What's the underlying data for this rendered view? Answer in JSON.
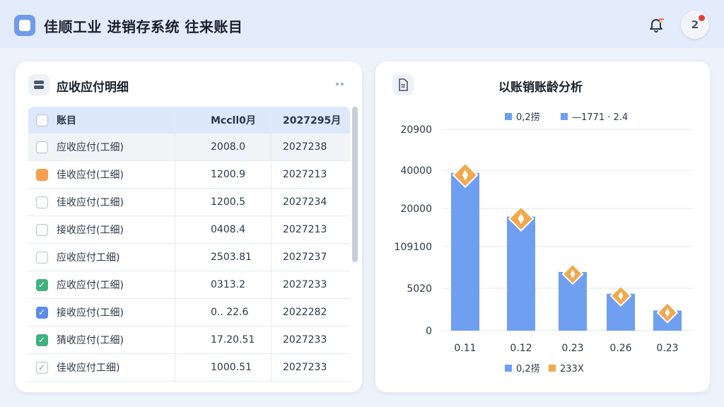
{
  "header": {
    "title": "佳顺工业 进销存系统 往来账目",
    "avatar_text": "2"
  },
  "left_card": {
    "title": "应收应付明细",
    "columns": [
      "账目",
      "Mccll0月",
      "2027295月"
    ],
    "rows": [
      {
        "check": "empty-selected",
        "name": "应收应付(工细)",
        "amount": "2008.0",
        "date": "2027238"
      },
      {
        "check": "orange",
        "name": "佳收应付(工细)",
        "amount": "1200.9",
        "date": "2027213"
      },
      {
        "check": "empty",
        "name": "佳收应付(工细)",
        "amount": "1200.5",
        "date": "2027234"
      },
      {
        "check": "empty",
        "name": "接收应付(工细)",
        "amount": "0408.4",
        "date": "2027213"
      },
      {
        "check": "empty",
        "name": "应收应付工细)",
        "amount": "2503.81",
        "date": "2027237"
      },
      {
        "check": "green",
        "name": "应收应付(工细)",
        "amount": "0313.2",
        "date": "2027233"
      },
      {
        "check": "blue",
        "name": "接收应付(工细)",
        "amount": "0.. 22.6",
        "date": "2022282"
      },
      {
        "check": "green",
        "name": "猜收应付(工细)",
        "amount": "17.20.51",
        "date": "2027233"
      },
      {
        "check": "gray",
        "name": "佳收应付工细)",
        "amount": "1000.51",
        "date": "2027233"
      }
    ]
  },
  "right_card": {
    "title": "以账销账龄分析"
  },
  "chart_data": {
    "type": "bar",
    "title": "以账销账龄分析",
    "legend_top": [
      "0,2捞",
      "—1771 · 2.4"
    ],
    "legend_bottom": [
      "0,2捞",
      "233X"
    ],
    "y_tick_labels": [
      "20900",
      "40000",
      "20000",
      "109100",
      "5020",
      "0"
    ],
    "categories": [
      "0.11",
      "0.12",
      "0.23",
      "0.26",
      "0.23"
    ],
    "series": [
      {
        "name": "0,2捞",
        "values": [
          47000,
          34000,
          17500,
          11000,
          6000
        ],
        "color": "#6f9ff0"
      },
      {
        "name": "233X",
        "values": [
          47000,
          34000,
          17500,
          11000,
          6000
        ],
        "color": "#f1a94e"
      }
    ],
    "ylim": [
      0,
      60000
    ]
  },
  "check_glyph": "✓"
}
